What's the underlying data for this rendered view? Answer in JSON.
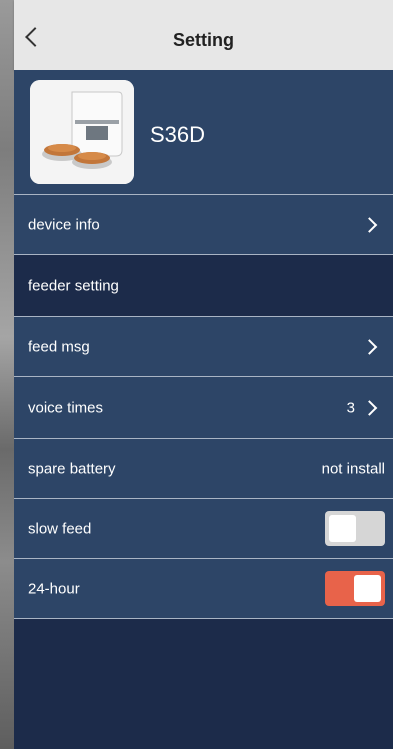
{
  "header": {
    "title": "Setting"
  },
  "device": {
    "name": "S36D",
    "image_icon": "pet-feeder-image"
  },
  "rows": [
    {
      "label": "device info",
      "value": "",
      "control": "chevron"
    },
    {
      "label": "feeder setting",
      "value": "",
      "control": "none"
    },
    {
      "label": "feed msg",
      "value": "",
      "control": "chevron"
    },
    {
      "label": "voice times",
      "value": "3",
      "control": "chevron"
    },
    {
      "label": "spare battery",
      "value": "not install",
      "control": "none"
    },
    {
      "label": "slow feed",
      "value": "",
      "control": "toggle",
      "on": false
    },
    {
      "label": "24-hour",
      "value": "",
      "control": "toggle",
      "on": true
    }
  ],
  "colors": {
    "header_bg": "#e7e7e7",
    "row_bg": "#2d4567",
    "section_bg": "#1c2b4a",
    "toggle_on": "#e8634a",
    "toggle_off": "#d6d6d6"
  }
}
